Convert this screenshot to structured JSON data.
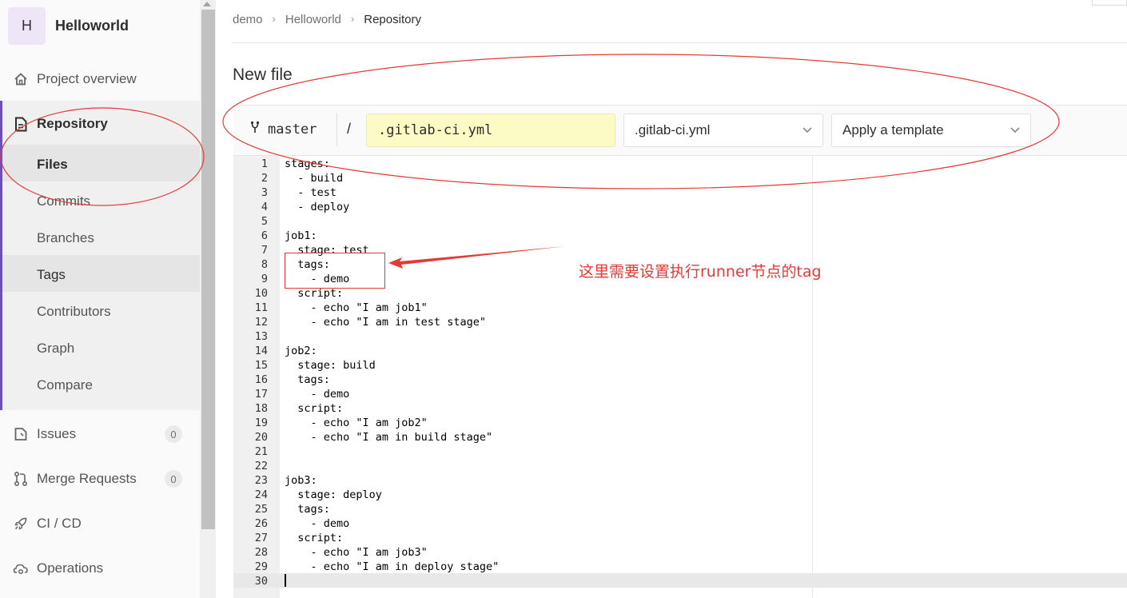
{
  "project": {
    "avatar_letter": "H",
    "name": "Helloworld"
  },
  "sidebar": {
    "overview": "Project overview",
    "repository": "Repository",
    "sub_items": [
      "Files",
      "Commits",
      "Branches",
      "Tags",
      "Contributors",
      "Graph",
      "Compare"
    ],
    "issues": {
      "label": "Issues",
      "count": "0"
    },
    "merge_requests": {
      "label": "Merge Requests",
      "count": "0"
    },
    "cicd": "CI / CD",
    "operations": "Operations"
  },
  "breadcrumb": {
    "items": [
      "demo",
      "Helloworld",
      "Repository"
    ],
    "separator": "›"
  },
  "page": {
    "title": "New file"
  },
  "file_bar": {
    "branch": "master",
    "slash": "/",
    "filename": ".gitlab-ci.yml",
    "type_dropdown": ".gitlab-ci.yml",
    "template_dropdown": "Apply a template"
  },
  "editor": {
    "lines": [
      "stages:",
      "  - build",
      "  - test",
      "  - deploy",
      "",
      "job1:",
      "  stage: test",
      "  tags:",
      "    - demo",
      "  script:",
      "    - echo \"I am job1\"",
      "    - echo \"I am in test stage\"",
      "",
      "job2:",
      "  stage: build",
      "  tags:",
      "    - demo",
      "  script:",
      "    - echo \"I am job2\"",
      "    - echo \"I am in build stage\"",
      "",
      "",
      "job3:",
      "  stage: deploy",
      "  tags:",
      "    - demo",
      "  script:",
      "    - echo \"I am job3\"",
      "    - echo \"I am in deploy stage\"",
      ""
    ]
  },
  "annotation": {
    "note": "这里需要设置执行runner节点的tag",
    "color": "#e53935"
  },
  "colors": {
    "accent": "#6b4fbb",
    "filename_bg": "#fcfbc5",
    "sidebar_bg": "#fafafa"
  }
}
